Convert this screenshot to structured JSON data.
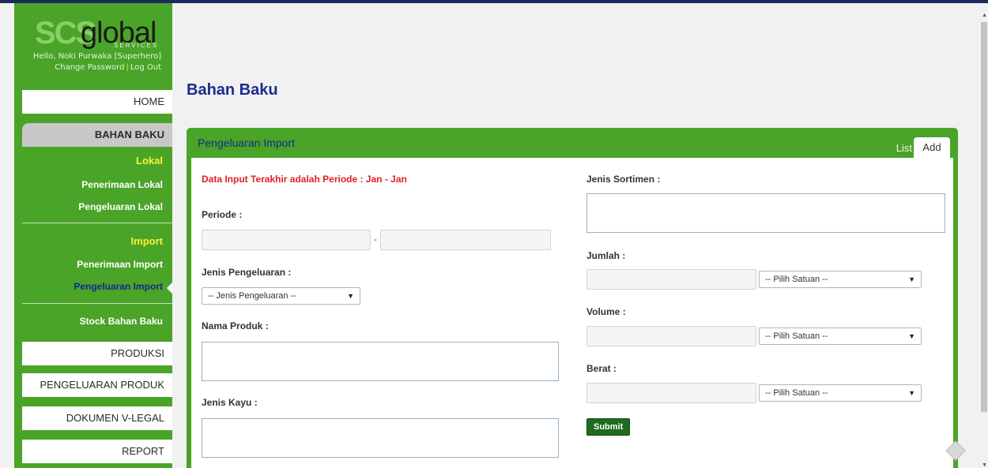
{
  "logo": {
    "scs": "SCS",
    "global": "global",
    "services": "SERVICES"
  },
  "user": {
    "hello": "Hello, Noki Purwaka [Superhero]",
    "change_password": "Change Password",
    "separator": "|",
    "logout": "Log Out"
  },
  "nav": {
    "home": "HOME",
    "bahan_baku": "BAHAN BAKU",
    "lokal_head": "Lokal",
    "penerimaan_lokal": "Penerimaan Lokal",
    "pengeluaran_lokal": "Pengeluaran Lokal",
    "import_head": "Import",
    "penerimaan_import": "Penerimaan Import",
    "pengeluaran_import": "Pengeluaran Import",
    "stock": "Stock Bahan Baku",
    "produksi": "PRODUKSI",
    "pengeluaran_produk": "PENGELUARAN PRODUK",
    "dokumen": "DOKUMEN V-LEGAL",
    "report": "REPORT"
  },
  "page": {
    "title": "Bahan Baku"
  },
  "panel": {
    "title": "Pengeluaran Import",
    "tab_list": "List",
    "tab_add": "Add"
  },
  "form": {
    "notice": "Data Input Terakhir adalah Periode : Jan - Jan",
    "periode_label": "Periode :",
    "periode_sep": "-",
    "jenis_pengeluaran_label": "Jenis Pengeluaran :",
    "jenis_pengeluaran_select": "-- Jenis Pengeluaran --",
    "nama_produk_label": "Nama Produk :",
    "jenis_kayu_label": "Jenis Kayu :",
    "jenis_sortimen_label": "Jenis Sortimen :",
    "jumlah_label": "Jumlah :",
    "volume_label": "Volume :",
    "berat_label": "Berat :",
    "satuan_select": "-- Pilih Satuan --",
    "submit": "Submit"
  },
  "icons": {
    "dropdown": "chevron-down-icon",
    "scroll_up": "scroll-up-icon",
    "scroll_down": "scroll-down-icon"
  }
}
